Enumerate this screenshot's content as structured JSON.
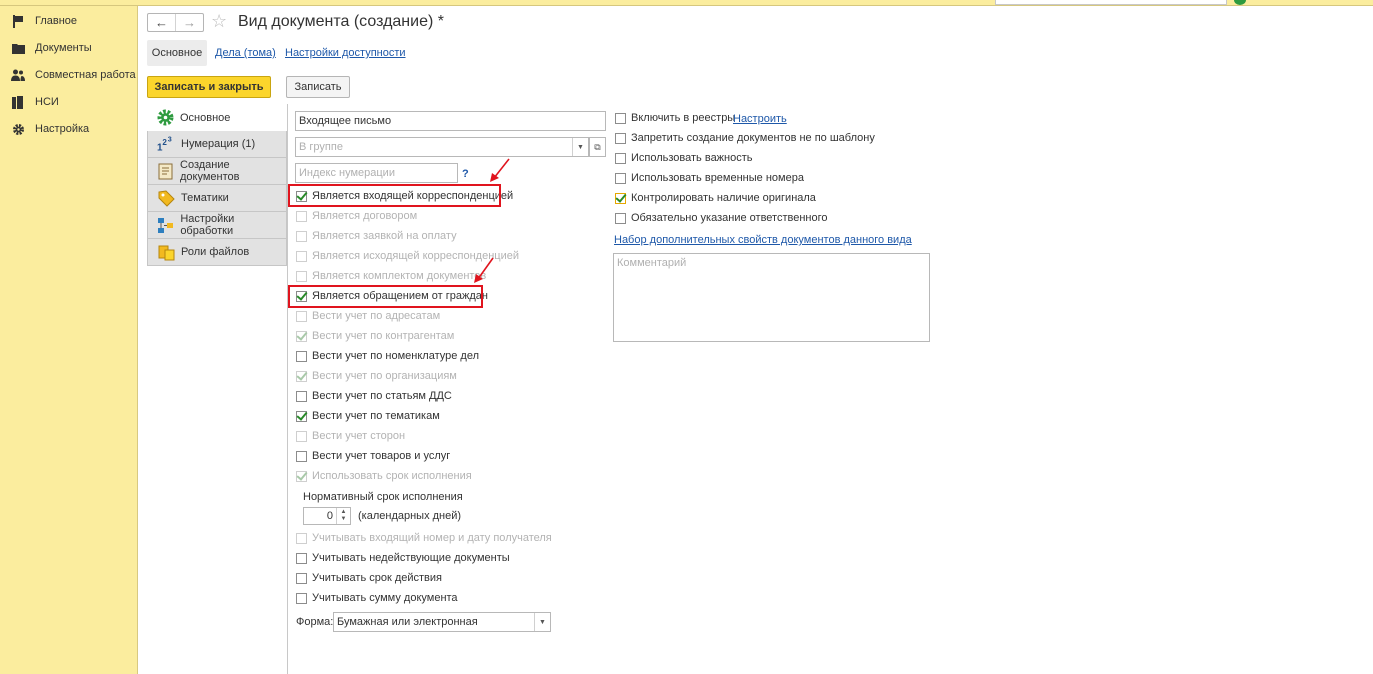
{
  "sidebar": {
    "items": [
      {
        "label": "Главное",
        "icon": "flag-icon"
      },
      {
        "label": "Документы",
        "icon": "folder-icon"
      },
      {
        "label": "Совместная работа",
        "icon": "users-icon"
      },
      {
        "label": "НСИ",
        "icon": "books-icon"
      },
      {
        "label": "Настройка",
        "icon": "gear-icon"
      }
    ]
  },
  "header": {
    "back_icon": "←",
    "forward_icon": "→",
    "star_icon": "☆",
    "title": "Вид документа (создание) *"
  },
  "tabs": [
    {
      "label": "Основное",
      "active": true
    },
    {
      "label": "Дела (тома)"
    },
    {
      "label": "Настройки доступности"
    }
  ],
  "toolbar": {
    "save_close_label": "Записать и закрыть",
    "save_label": "Записать"
  },
  "vertical_tabs": [
    {
      "label": "Основное",
      "icon": "gear-green-icon",
      "active": true
    },
    {
      "label": "Нумерация (1)",
      "icon": "numbering-icon"
    },
    {
      "label": "Создание документов",
      "icon": "document-template-icon"
    },
    {
      "label": "Тематики",
      "icon": "tag-icon"
    },
    {
      "label": "Настройки обработки",
      "icon": "workflow-icon"
    },
    {
      "label": "Роли файлов",
      "icon": "file-roles-icon"
    }
  ],
  "form": {
    "name_value": "Входящее письмо",
    "group_placeholder": "В группе",
    "group_dropdown_icon": "▼",
    "group_open_icon": "⧉",
    "index_placeholder": "Индекс нумерации",
    "help_label": "?",
    "checkboxes_left": [
      {
        "label": "Является входящей корреспонденцией",
        "checked": true,
        "disabled": false
      },
      {
        "label": "Является договором",
        "checked": false,
        "disabled": true
      },
      {
        "label": "Является заявкой на оплату",
        "checked": false,
        "disabled": true
      },
      {
        "label": "Является исходящей корреспонденцией",
        "checked": false,
        "disabled": true
      },
      {
        "label": "Является комплектом документов",
        "checked": false,
        "disabled": true
      },
      {
        "label": "Является обращением от граждан",
        "checked": true,
        "disabled": false
      },
      {
        "label": "Вести учет по адресатам",
        "checked": false,
        "disabled": true
      },
      {
        "label": "Вести учет по контрагентам",
        "checked": true,
        "disabled": true
      },
      {
        "label": "Вести учет по номенклатуре дел",
        "checked": false,
        "disabled": false
      },
      {
        "label": "Вести учет по организациям",
        "checked": true,
        "disabled": true
      },
      {
        "label": "Вести учет по статьям ДДС",
        "checked": false,
        "disabled": false
      },
      {
        "label": "Вести учет по тематикам",
        "checked": true,
        "disabled": false
      },
      {
        "label": "Вести учет сторон",
        "checked": false,
        "disabled": true
      },
      {
        "label": "Вести учет товаров и услуг",
        "checked": false,
        "disabled": false
      },
      {
        "label": "Использовать срок исполнения",
        "checked": true,
        "disabled": true
      }
    ],
    "deadline_label": "Нормативный срок исполнения",
    "deadline_value": "0",
    "deadline_unit": "(календарных дней)",
    "checkboxes_left_bottom": [
      {
        "label": "Учитывать входящий номер и дату получателя",
        "checked": false,
        "disabled": true
      },
      {
        "label": "Учитывать недействующие документы",
        "checked": false,
        "disabled": false
      },
      {
        "label": "Учитывать срок действия",
        "checked": false,
        "disabled": false
      },
      {
        "label": "Учитывать сумму документа",
        "checked": false,
        "disabled": false
      }
    ],
    "form_label": "Форма:",
    "form_value": "Бумажная или электронная",
    "form_dropdown_icon": "▼",
    "checkboxes_right": [
      {
        "label": "Включить в реестры",
        "checked": false,
        "link": "Настроить"
      },
      {
        "label": "Запретить создание документов не по шаблону",
        "checked": false
      },
      {
        "label": "Использовать важность",
        "checked": false
      },
      {
        "label": "Использовать временные номера",
        "checked": false
      },
      {
        "label": "Контролировать наличие оригинала",
        "checked": true
      },
      {
        "label": "Обязательно указание ответственного",
        "checked": false
      }
    ],
    "extra_props_link": "Набор дополнительных свойств документов данного вида",
    "comment_placeholder": "Комментарий"
  },
  "colors": {
    "sidebar_bg": "#fbed9e",
    "primary_button": "#fbd52c",
    "link": "#1e58a9",
    "highlight_red": "#e0141e",
    "check_green": "#2a8a2a"
  }
}
